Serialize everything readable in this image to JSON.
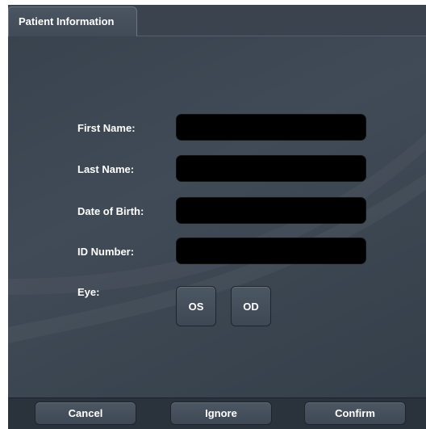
{
  "tabs": [
    {
      "label": "Patient Information",
      "active": true
    }
  ],
  "form": {
    "fields": [
      {
        "label": "First Name:",
        "value": ""
      },
      {
        "label": "Last Name:",
        "value": ""
      },
      {
        "label": "Date of Birth:",
        "value": ""
      },
      {
        "label": "ID Number:",
        "value": ""
      }
    ],
    "eye": {
      "label": "Eye:",
      "options": [
        "OS",
        "OD"
      ]
    }
  },
  "footer": {
    "cancel_label": "Cancel",
    "ignore_label": "Ignore",
    "confirm_label": "Confirm"
  },
  "colors": {
    "background": "#2c3540",
    "input": "#000000",
    "text": "#ffffff"
  }
}
